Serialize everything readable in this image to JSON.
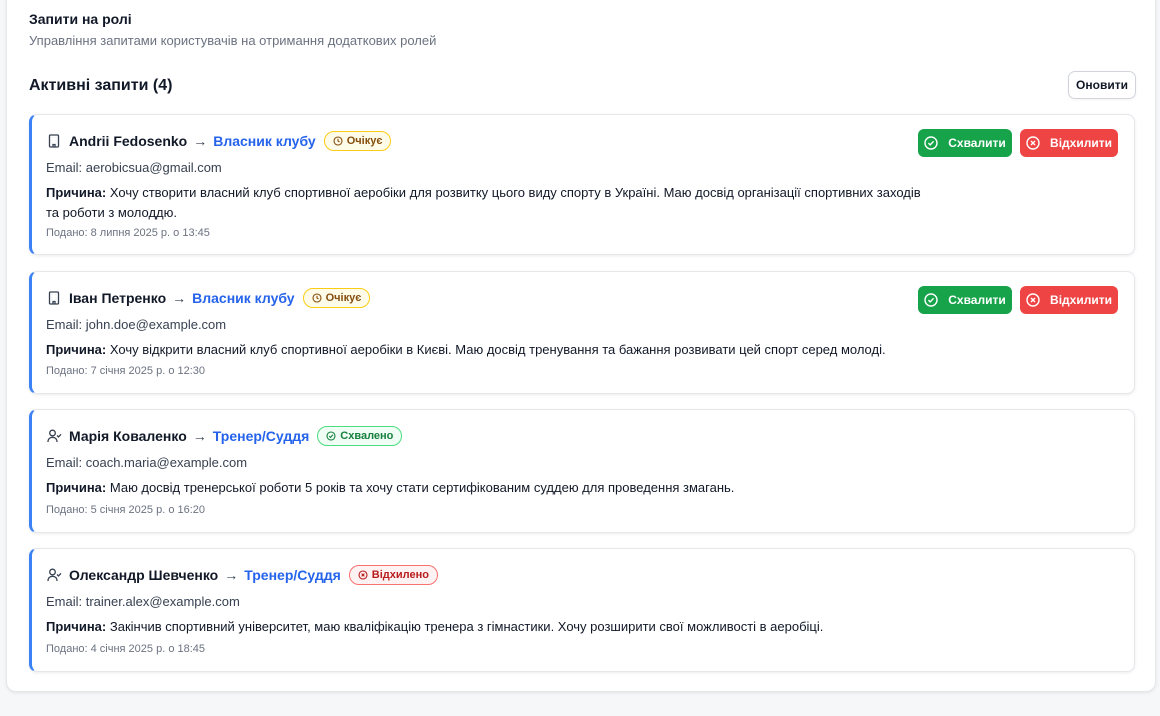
{
  "page": {
    "title": "Запити на ролі",
    "subtitle": "Управління запитами користувачів на отримання додаткових ролей",
    "list_heading": "Активні запити (4)",
    "refresh_label": "Оновити"
  },
  "labels": {
    "email_prefix": "Email: ",
    "reason_prefix": "Причина:",
    "approve": "Схвалити",
    "reject": "Відхилити",
    "arrow": "→"
  },
  "requests": [
    {
      "name": "Andrii Fedosenko",
      "role": "Власник клубу",
      "role_icon": "building-icon",
      "status": "Очікує",
      "status_kind": "pending",
      "email": "aerobicsua@gmail.com",
      "reason": "Хочу створити власний клуб спортивної аеробіки для розвитку цього виду спорту в Україні. Маю досвід організації спортивних заходів та роботи з молоддю.",
      "submitted": "Подано: 8 липня 2025 р. о 13:45",
      "actions": true
    },
    {
      "name": "Іван Петренко",
      "role": "Власник клубу",
      "role_icon": "building-icon",
      "status": "Очікує",
      "status_kind": "pending",
      "email": "john.doe@example.com",
      "reason": "Хочу відкрити власний клуб спортивної аеробіки в Києві. Маю досвід тренування та бажання розвивати цей спорт серед молоді.",
      "submitted": "Подано: 7 січня 2025 р. о 12:30",
      "actions": true
    },
    {
      "name": "Марія Коваленко",
      "role": "Тренер/Суддя",
      "role_icon": "user-check-icon",
      "status": "Схвалено",
      "status_kind": "approved",
      "email": "coach.maria@example.com",
      "reason": "Маю досвід тренерської роботи 5 років та хочу стати сертифікованим суддею для проведення змагань.",
      "submitted": "Подано: 5 січня 2025 р. о 16:20",
      "actions": false
    },
    {
      "name": "Олександр Шевченко",
      "role": "Тренер/Суддя",
      "role_icon": "user-check-icon",
      "status": "Відхилено",
      "status_kind": "rejected",
      "email": "trainer.alex@example.com",
      "reason": "Закінчив спортивний університет, маю кваліфікацію тренера з гімнастики. Хочу розширити свої можливості в аеробіці.",
      "submitted": "Подано: 4 січня 2025 р. о 18:45",
      "actions": false
    }
  ],
  "colors": {
    "accent_blue": "#2563eb",
    "approve_green": "#16a34a",
    "reject_red": "#ef4444",
    "pending_yellow": "#facc15"
  }
}
